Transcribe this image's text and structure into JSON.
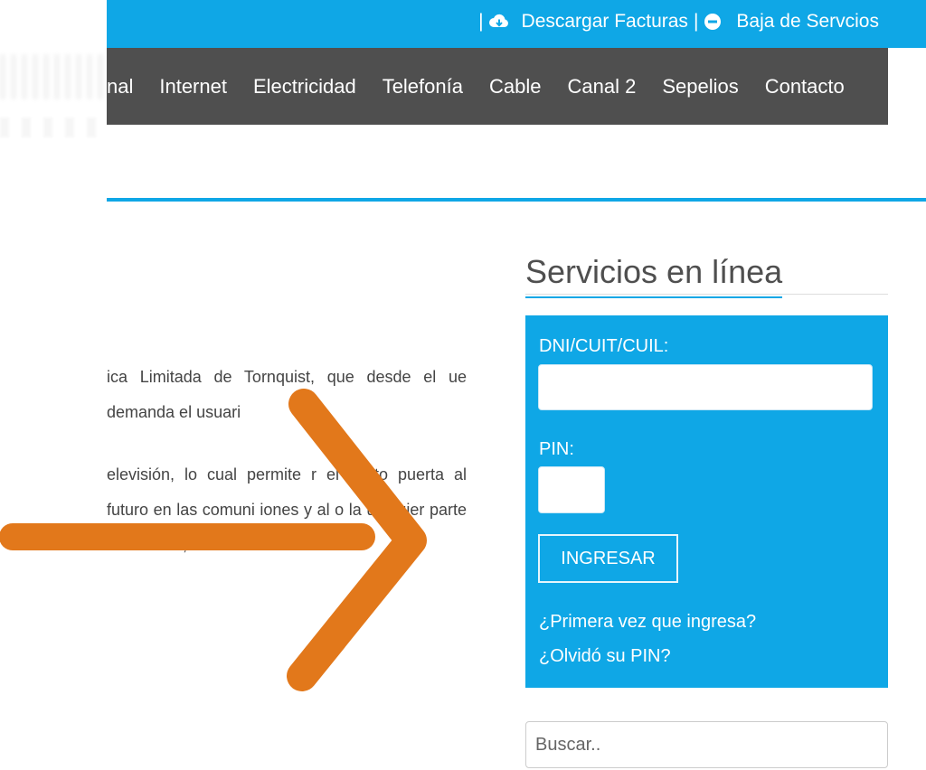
{
  "topbar": {
    "separator": "|",
    "download_invoices_label": "Descargar Facturas",
    "unsubscribe_label": "Baja de Servcios"
  },
  "nav": {
    "items": [
      "nal",
      "Internet",
      "Electricidad",
      "Telefonía",
      "Cable",
      "Canal 2",
      "Sepelios",
      "Contacto"
    ]
  },
  "article": {
    "paragraphs": [
      "ica Limitada de Tornquist, que desde el ue demanda el usuari",
      "elevisión, lo cual permite  r el costo puerta al futuro en las comuni  iones y  al   o la ualquier parte del mundo, con   o hacer"
    ]
  },
  "sidebar": {
    "title": "Servicios en línea",
    "dni_label": "DNI/CUIT/CUIL:",
    "dni_value": "",
    "pin_label": "PIN:",
    "pin_value": "",
    "submit_label": "INGRESAR",
    "first_time_link": "¿Primera vez que ingresa?",
    "forgot_pin_link": "¿Olvidó su PIN?"
  },
  "search": {
    "placeholder": "Buscar.."
  },
  "colors": {
    "brand_blue": "#0fa7e6",
    "nav_gray": "#4f4f4f",
    "annotation_orange": "#e2781b"
  },
  "icons": {
    "download": "cloud-download-icon",
    "unsubscribe": "minus-circle-icon"
  }
}
